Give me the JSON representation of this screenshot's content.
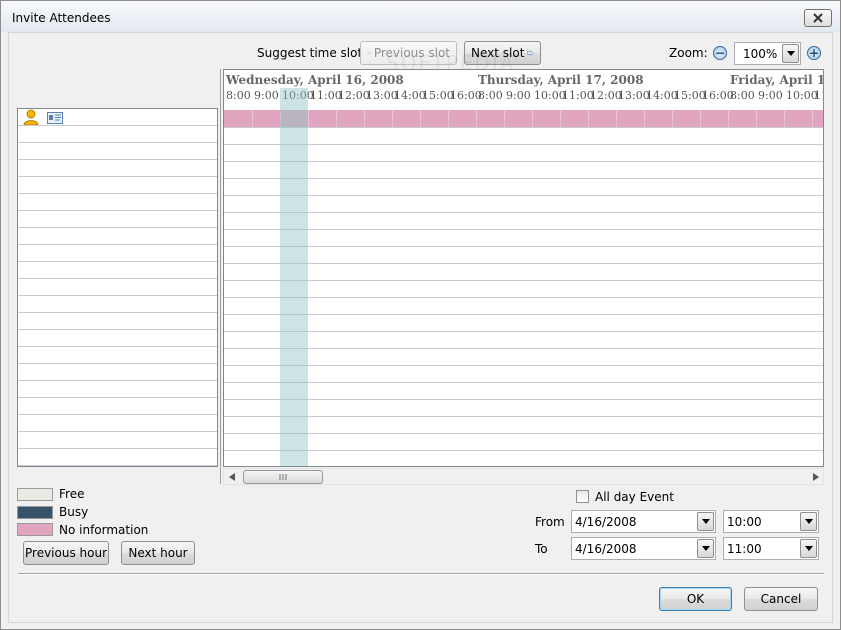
{
  "window": {
    "title": "Invite Attendees",
    "close_icon": "close-icon"
  },
  "toolbar": {
    "suggest_label": "Suggest time slot:",
    "previous_slot": "Previous slot",
    "next_slot": "Next slot",
    "zoom_label": "Zoom:",
    "zoom_value": "100%"
  },
  "timeline": {
    "days": [
      "Wednesday, April 16, 2008",
      "Thursday, April 17, 2008",
      "Friday, April 18, 2"
    ],
    "hours_day1": [
      "8:00",
      "9:00",
      "10:00",
      "11:00",
      "12:00",
      "13:00",
      "14:00",
      "15:00",
      "16:00"
    ],
    "hours_day2": [
      "8:00",
      "9:00",
      "10:00",
      "11:00",
      "12:00",
      "13:00",
      "14:00",
      "15:00",
      "16:00"
    ],
    "hours_day3": [
      "8:00",
      "9:00",
      "10:00",
      "11:"
    ],
    "colors": {
      "no_information": "#e2a5c0",
      "selection": "#8dc6c4",
      "free": "#eaeae5",
      "busy": "#36536a"
    }
  },
  "legend": {
    "free": "Free",
    "busy": "Busy",
    "no_information": "No information"
  },
  "nav": {
    "previous_hour": "Previous hour",
    "next_hour": "Next hour"
  },
  "event": {
    "all_day_label": "All day Event",
    "from_label": "From",
    "to_label": "To",
    "from_date": "4/16/2008",
    "from_time": "10:00",
    "to_date": "4/16/2008",
    "to_time": "11:00"
  },
  "dialog": {
    "ok": "OK",
    "cancel": "Cancel"
  },
  "watermark": "SOFTPEDIA"
}
